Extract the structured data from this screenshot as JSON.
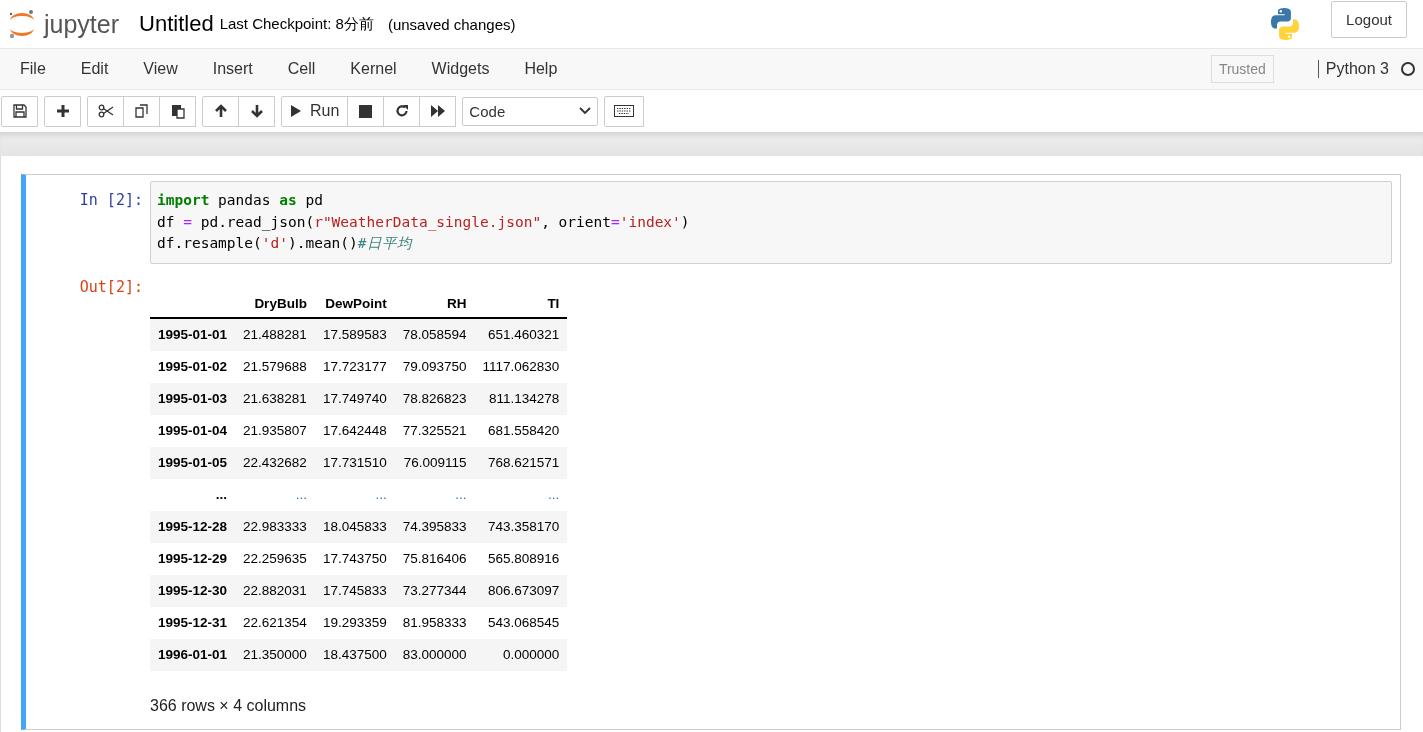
{
  "header": {
    "logo_text": "jupyter",
    "notebook_name": "Untitled",
    "checkpoint": "Last Checkpoint: 8分前",
    "autosave_status": "(unsaved changes)",
    "logout": "Logout"
  },
  "menu": [
    "File",
    "Edit",
    "View",
    "Insert",
    "Cell",
    "Kernel",
    "Widgets",
    "Help"
  ],
  "trusted": "Trusted",
  "kernel_name": "Python 3",
  "toolbar": {
    "run_label": "Run",
    "cell_type": "Code"
  },
  "cell": {
    "prompt_in": "In [2]:",
    "prompt_out": "Out[2]:",
    "selected": true,
    "code": [
      [
        {
          "kind": "kw",
          "text": "import"
        },
        {
          "kind": "plain",
          "text": " pandas "
        },
        {
          "kind": "kw",
          "text": "as"
        },
        {
          "kind": "plain",
          "text": " pd"
        }
      ],
      [
        {
          "kind": "plain",
          "text": "df "
        },
        {
          "kind": "op",
          "text": "="
        },
        {
          "kind": "plain",
          "text": " pd.read_json("
        },
        {
          "kind": "str",
          "text": "r\"WeatherData_single.json\""
        },
        {
          "kind": "plain",
          "text": ", orient"
        },
        {
          "kind": "op",
          "text": "="
        },
        {
          "kind": "str",
          "text": "'index'"
        },
        {
          "kind": "plain",
          "text": ")"
        }
      ],
      [
        {
          "kind": "plain",
          "text": "df.resample("
        },
        {
          "kind": "str",
          "text": "'d'"
        },
        {
          "kind": "plain",
          "text": ").mean()"
        },
        {
          "kind": "comment",
          "text": "#日平均"
        }
      ]
    ]
  },
  "table": {
    "columns": [
      "DryBulb",
      "DewPoint",
      "RH",
      "TI"
    ],
    "rows": [
      {
        "kind": "data",
        "index": "1995-01-01",
        "cells": [
          "21.488281",
          "17.589583",
          "78.058594",
          "651.460321"
        ]
      },
      {
        "kind": "data",
        "index": "1995-01-02",
        "cells": [
          "21.579688",
          "17.723177",
          "79.093750",
          "1117.062830"
        ]
      },
      {
        "kind": "data",
        "index": "1995-01-03",
        "cells": [
          "21.638281",
          "17.749740",
          "78.826823",
          "811.134278"
        ]
      },
      {
        "kind": "data",
        "index": "1995-01-04",
        "cells": [
          "21.935807",
          "17.642448",
          "77.325521",
          "681.558420"
        ]
      },
      {
        "kind": "data",
        "index": "1995-01-05",
        "cells": [
          "22.432682",
          "17.731510",
          "76.009115",
          "768.621571"
        ]
      },
      {
        "kind": "ellipsis",
        "index": "...",
        "cells": [
          "...",
          "...",
          "...",
          "..."
        ]
      },
      {
        "kind": "data",
        "index": "1995-12-28",
        "cells": [
          "22.983333",
          "18.045833",
          "74.395833",
          "743.358170"
        ]
      },
      {
        "kind": "data",
        "index": "1995-12-29",
        "cells": [
          "22.259635",
          "17.743750",
          "75.816406",
          "565.808916"
        ]
      },
      {
        "kind": "data",
        "index": "1995-12-30",
        "cells": [
          "22.882031",
          "17.745833",
          "73.277344",
          "806.673097"
        ]
      },
      {
        "kind": "data",
        "index": "1995-12-31",
        "cells": [
          "22.621354",
          "19.293359",
          "81.958333",
          "543.068545"
        ]
      },
      {
        "kind": "data",
        "index": "1996-01-01",
        "cells": [
          "21.350000",
          "18.437500",
          "83.000000",
          "0.000000"
        ]
      }
    ],
    "shape": "366 rows × 4 columns"
  }
}
